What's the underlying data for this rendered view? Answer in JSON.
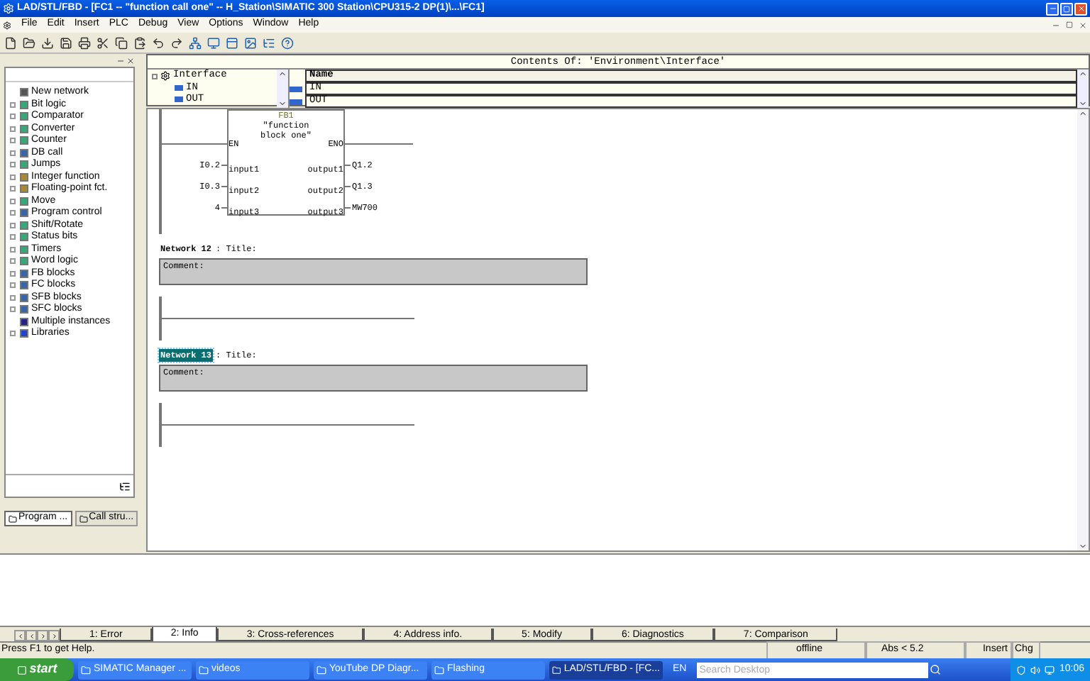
{
  "window": {
    "title": "LAD/STL/FBD  - [FC1 -- \"function call one\" -- H_Station\\SIMATIC 300 Station\\CPU315-2 DP(1)\\...\\FC1]"
  },
  "menu": [
    "File",
    "Edit",
    "Insert",
    "PLC",
    "Debug",
    "View",
    "Options",
    "Window",
    "Help"
  ],
  "catalog": {
    "items": [
      {
        "label": "New network",
        "expandable": false
      },
      {
        "label": "Bit logic",
        "expandable": true
      },
      {
        "label": "Comparator",
        "expandable": true
      },
      {
        "label": "Converter",
        "expandable": true
      },
      {
        "label": "Counter",
        "expandable": true
      },
      {
        "label": "DB call",
        "expandable": true
      },
      {
        "label": "Jumps",
        "expandable": true
      },
      {
        "label": "Integer function",
        "expandable": true
      },
      {
        "label": "Floating-point fct.",
        "expandable": true
      },
      {
        "label": "Move",
        "expandable": true
      },
      {
        "label": "Program control",
        "expandable": true
      },
      {
        "label": "Shift/Rotate",
        "expandable": true
      },
      {
        "label": "Status bits",
        "expandable": true
      },
      {
        "label": "Timers",
        "expandable": true
      },
      {
        "label": "Word logic",
        "expandable": true
      },
      {
        "label": "FB blocks",
        "expandable": true
      },
      {
        "label": "FC blocks",
        "expandable": true
      },
      {
        "label": "SFB blocks",
        "expandable": true
      },
      {
        "label": "SFC blocks",
        "expandable": true
      },
      {
        "label": "Multiple instances",
        "expandable": false
      },
      {
        "label": "Libraries",
        "expandable": true
      }
    ],
    "tabs": [
      {
        "label": "Program ...",
        "selected": true
      },
      {
        "label": "Call stru...",
        "selected": false
      }
    ]
  },
  "interface": {
    "heading": "Contents Of: 'Environment\\Interface'",
    "tree": {
      "label": "Interface",
      "expanded": true,
      "children": [
        {
          "label": "IN"
        },
        {
          "label": "OUT"
        }
      ]
    },
    "column": "Name",
    "rows": [
      "IN",
      "OUT"
    ]
  },
  "block": {
    "name": "FB1",
    "title": [
      "\"function",
      "block one\""
    ],
    "en": "EN",
    "eno": "ENO",
    "inputs": [
      {
        "operand": "I0.2",
        "pin": "input1"
      },
      {
        "operand": "I0.3",
        "pin": "input2"
      },
      {
        "operand": "4",
        "pin": "input3"
      }
    ],
    "outputs": [
      {
        "pin": "output1",
        "operand": "Q1.2"
      },
      {
        "pin": "output2",
        "operand": "Q1.3"
      },
      {
        "pin": "output3",
        "operand": "MW700"
      }
    ]
  },
  "networks": [
    {
      "number": "Network 12",
      "title": ": Title:",
      "comment": "Comment:",
      "selected": false
    },
    {
      "number": "Network 13",
      "title": ": Title:",
      "comment": "Comment:",
      "selected": true
    }
  ],
  "output_tabs": [
    {
      "label": "1: Error",
      "selected": false
    },
    {
      "label": "2: Info",
      "selected": true
    },
    {
      "label": "3: Cross-references",
      "selected": false
    },
    {
      "label": "4: Address info.",
      "selected": false
    },
    {
      "label": "5: Modify",
      "selected": false
    },
    {
      "label": "6: Diagnostics",
      "selected": false
    },
    {
      "label": "7: Comparison",
      "selected": false
    }
  ],
  "status_bar": {
    "help": "Press F1 to get Help.",
    "mode": "offline",
    "version": "Abs < 5.2",
    "insert": "Insert",
    "change": "Chg"
  },
  "taskbar": {
    "start": "start",
    "tasks": [
      {
        "label": "SIMATIC Manager ...",
        "selected": false
      },
      {
        "label": "videos",
        "selected": false
      },
      {
        "label": "YouTube DP Diagr...",
        "selected": false
      },
      {
        "label": "Flashing",
        "selected": false
      },
      {
        "label": "LAD/STL/FBD  - [FC...",
        "selected": true
      }
    ],
    "language": "EN",
    "search": {
      "placeholder": "Search Desktop"
    },
    "clock": "10:06"
  }
}
